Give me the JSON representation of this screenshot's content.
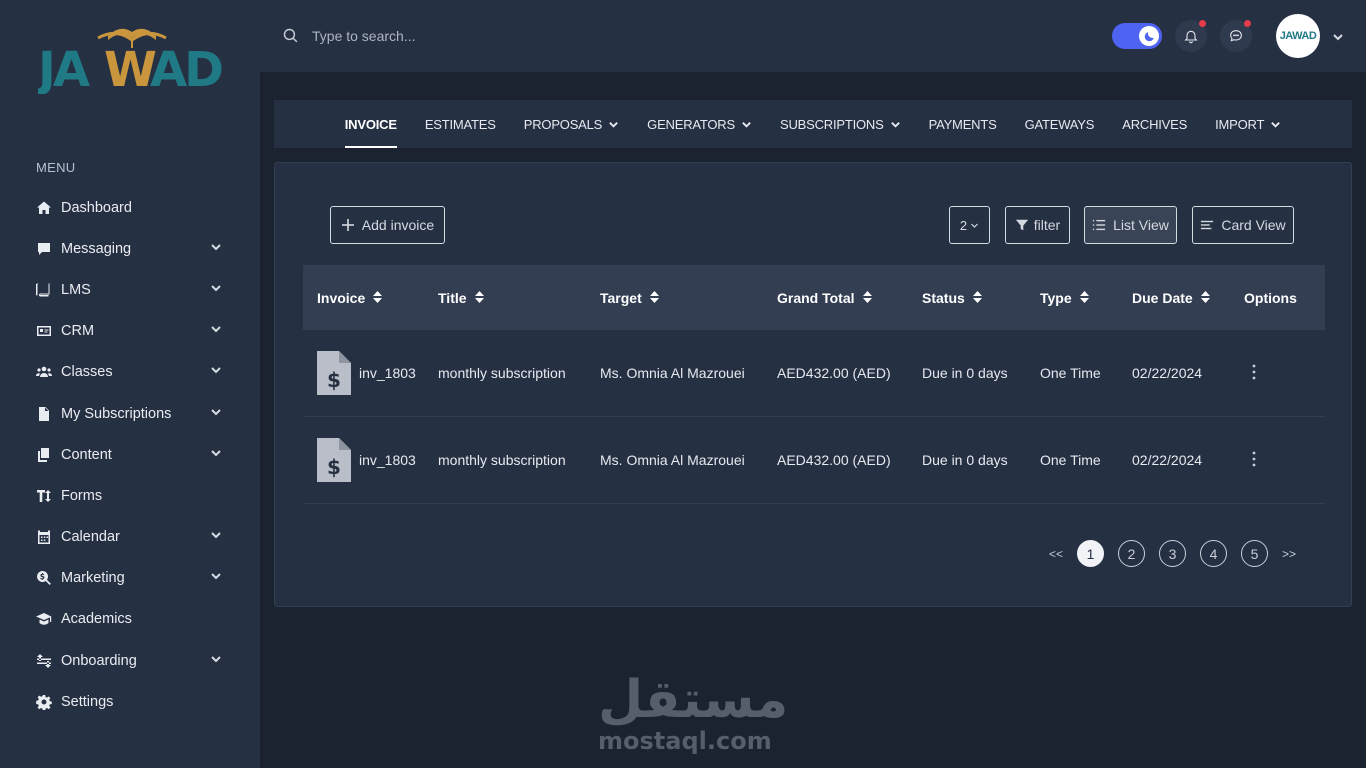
{
  "brand": {
    "logo_text": "JAWAD",
    "avatar_text": "JAWAD"
  },
  "sidebar": {
    "menu_title": "MENU",
    "items": [
      {
        "label": "Dashboard",
        "icon": "home-icon",
        "has_chevron": false
      },
      {
        "label": "Messaging",
        "icon": "message-icon",
        "has_chevron": true
      },
      {
        "label": "LMS",
        "icon": "book-icon",
        "has_chevron": true
      },
      {
        "label": "CRM",
        "icon": "id-card-icon",
        "has_chevron": true
      },
      {
        "label": "Classes",
        "icon": "users-icon",
        "has_chevron": true
      },
      {
        "label": "My Subscriptions",
        "icon": "document-icon",
        "has_chevron": true
      },
      {
        "label": "Content",
        "icon": "copy-icon",
        "has_chevron": true
      },
      {
        "label": "Forms",
        "icon": "text-height-icon",
        "has_chevron": false
      },
      {
        "label": "Calendar",
        "icon": "calendar-icon",
        "has_chevron": true
      },
      {
        "label": "Marketing",
        "icon": "search-dollar-icon",
        "has_chevron": true
      },
      {
        "label": "Academics",
        "icon": "graduation-cap-icon",
        "has_chevron": false
      },
      {
        "label": "Onboarding",
        "icon": "arrows-icon",
        "has_chevron": true
      },
      {
        "label": "Settings",
        "icon": "gear-icon",
        "has_chevron": false
      }
    ]
  },
  "topbar": {
    "search_placeholder": "Type to search...",
    "theme_toggle": "dark",
    "notifications_icon": "bell-icon",
    "messages_icon": "chat-icon"
  },
  "tabs": [
    {
      "label": "INVOICE",
      "active": true,
      "dropdown": false
    },
    {
      "label": "ESTIMATES",
      "active": false,
      "dropdown": false
    },
    {
      "label": "PROPOSALS",
      "active": false,
      "dropdown": true
    },
    {
      "label": "GENERATORS",
      "active": false,
      "dropdown": true
    },
    {
      "label": "SUBSCRIPTIONS",
      "active": false,
      "dropdown": true
    },
    {
      "label": "PAYMENTS",
      "active": false,
      "dropdown": false
    },
    {
      "label": "GATEWAYS",
      "active": false,
      "dropdown": false
    },
    {
      "label": "ARCHIVES",
      "active": false,
      "dropdown": false
    },
    {
      "label": "IMPORT",
      "active": false,
      "dropdown": true
    }
  ],
  "toolbar": {
    "add_label": "Add invoice",
    "page_size": "2",
    "filter_label": "filter",
    "list_view_label": "List View",
    "card_view_label": "Card View"
  },
  "table": {
    "columns": [
      "Invoice",
      "Title",
      "Target",
      "Grand Total",
      "Status",
      "Type",
      "Due Date",
      "Options"
    ],
    "rows": [
      {
        "invoice": "inv_1803",
        "title": "monthly subscription",
        "target": "Ms. Omnia Al Mazrouei",
        "grand_total": "AED432.00 (AED)",
        "status": "Due in 0 days",
        "type": "One Time",
        "due_date": "02/22/2024"
      },
      {
        "invoice": "inv_1803",
        "title": "monthly subscription",
        "target": "Ms. Omnia Al Mazrouei",
        "grand_total": "AED432.00 (AED)",
        "status": "Due in 0 days",
        "type": "One Time",
        "due_date": "02/22/2024"
      }
    ]
  },
  "pagination": {
    "prev": "<<",
    "next": ">>",
    "pages": [
      "1",
      "2",
      "3",
      "4",
      "5"
    ],
    "current": "1"
  },
  "watermark": {
    "arabic": "مستقل",
    "latin": "mostaql.com"
  },
  "colors": {
    "accent": "#4e63f2",
    "sidebar_bg": "#263043",
    "page_bg": "#1b2230",
    "notification_dot": "#e53b4b"
  }
}
